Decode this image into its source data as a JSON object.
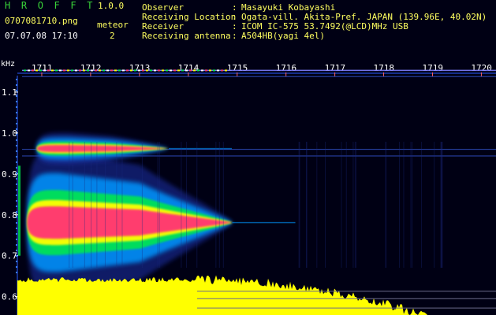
{
  "header": {
    "app_title": "H R O F F T",
    "app_version": "1.0.0",
    "file_name": "0707081710.png",
    "date_time": "07.07.08 17:10",
    "count_label": "meteor",
    "count_value": "2"
  },
  "meta": [
    {
      "label": "Observer",
      "value": "Masayuki Kobayashi"
    },
    {
      "label": "Receiving Location",
      "value": "Ogata-vill. Akita-Pref. JAPAN (139.96E, 40.02N)"
    },
    {
      "label": "Receiver",
      "value": "ICOM IC-575 53.7492(@LCD)MHz USB"
    },
    {
      "label": "Receiving antenna",
      "value": "A504HB(yagi 4el)"
    }
  ],
  "colors": {
    "background": "#000014",
    "header_green": "#39d339",
    "header_yellow": "#ffff60",
    "tick_label": "#ffffff",
    "signal_core": "#ff3c6e",
    "signal_bright": "#ffff00",
    "signal_mid": "#00e650",
    "signal_low": "#0096ff",
    "signal_faint": "#1e32aa",
    "level_fill": "#ffff00"
  },
  "chart_data": {
    "type": "heatmap",
    "y_unit": "kHz",
    "time_ticks": [
      "1711",
      "1712",
      "1713",
      "1714",
      "1715",
      "1716",
      "1717",
      "1718",
      "1719",
      "1720"
    ],
    "freq_ticks": [
      "1.1",
      "1.0",
      "0.9",
      "0.8",
      "0.7",
      "0.6"
    ],
    "time_range": [
      1710.5,
      1720.3
    ],
    "freq_range": [
      0.555,
      1.175
    ],
    "carrier_lines_khz": [
      1.153,
      1.138,
      0.96,
      0.944
    ],
    "meteor_echoes": [
      {
        "center_khz": 0.781,
        "start": 1710.7,
        "end": 1714.9,
        "spread_khz": 0.055
      },
      {
        "center_khz": 0.962,
        "start": 1710.9,
        "end": 1713.6,
        "spread_khz": 0.012
      }
    ]
  }
}
